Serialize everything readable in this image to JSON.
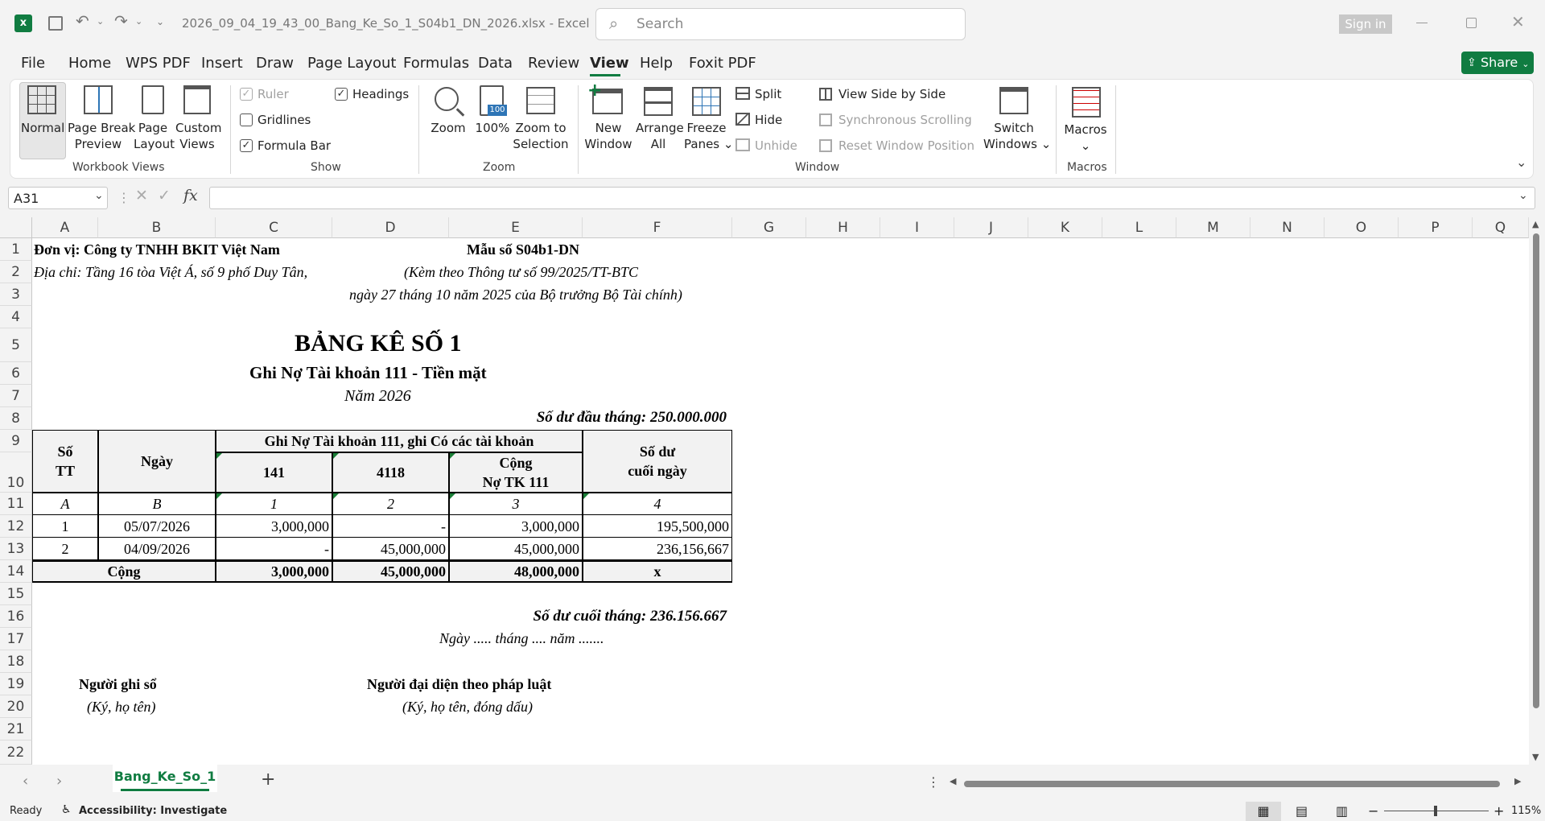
{
  "window": {
    "filename": "2026_09_04_19_43_00_Bang_Ke_So_1_S04b1_DN_2026.xlsx",
    "separator": "-",
    "app": "Excel",
    "search_placeholder": "Search",
    "sign_in": "Sign in"
  },
  "menu": [
    "File",
    "Home",
    "WPS PDF",
    "Insert",
    "Draw",
    "Page Layout",
    "Formulas",
    "Data",
    "Review",
    "View",
    "Help",
    "Foxit PDF"
  ],
  "share": "Share",
  "ribbon": {
    "workbook_views": {
      "normal": "Normal",
      "page_break": [
        "Page Break",
        "Preview"
      ],
      "page_layout": [
        "Page",
        "Layout"
      ],
      "custom": [
        "Custom",
        "Views"
      ],
      "label": "Workbook Views"
    },
    "show": {
      "ruler": "Ruler",
      "gridlines": "Gridlines",
      "formula_bar": "Formula Bar",
      "headings": "Headings",
      "label": "Show"
    },
    "zoom": {
      "zoom": "Zoom",
      "pct": "100%",
      "to_sel": [
        "Zoom to",
        "Selection"
      ],
      "label": "Zoom"
    },
    "window": {
      "new": [
        "New",
        "Window"
      ],
      "arrange": [
        "Arrange",
        "All"
      ],
      "freeze": [
        "Freeze",
        "Panes"
      ],
      "split": "Split",
      "hide": "Hide",
      "unhide": "Unhide",
      "side_by_side": "View Side by Side",
      "sync_scroll": "Synchronous Scrolling",
      "reset_pos": "Reset Window Position",
      "switch": [
        "Switch",
        "Windows"
      ],
      "label": "Window"
    },
    "macros": {
      "macros": "Macros",
      "label": "Macros"
    }
  },
  "formula_bar": {
    "name_box": "A31",
    "fx": "fx",
    "value": ""
  },
  "columns": [
    "A",
    "B",
    "C",
    "D",
    "E",
    "F",
    "G",
    "H",
    "I",
    "J",
    "K",
    "L",
    "M",
    "N",
    "O",
    "P",
    "Q"
  ],
  "rows": [
    "1",
    "2",
    "3",
    "4",
    "5",
    "6",
    "7",
    "8",
    "9",
    "10",
    "11",
    "12",
    "13",
    "14",
    "15",
    "16",
    "17",
    "18",
    "19",
    "20",
    "21",
    "22"
  ],
  "sheet": {
    "unit": "Đơn vị: Công ty TNHH BKIT Việt Nam",
    "form": "Mẫu số S04b1-DN",
    "address": "Địa chỉ: Tầng 16 tòa Việt Á, số 9 phố Duy Tân,",
    "circular": "(Kèm theo Thông tư số 99/2025/TT-BTC",
    "circular2": "ngày 27 tháng 10 năm 2025 của Bộ trưởng Bộ Tài chính)",
    "title": "BẢNG KÊ SỐ 1",
    "subtitle": "Ghi Nợ Tài khoản 111 - Tiền mặt",
    "year": "Năm 2026",
    "opening": "Số dư đầu tháng: 250.000.000",
    "h_stt": [
      "Số",
      "TT"
    ],
    "h_date": "Ngày",
    "h_group": "Ghi Nợ Tài khoản 111, ghi Có các tài khoản",
    "h_141": "141",
    "h_4118": "4118",
    "h_total": [
      "Cộng",
      "Nợ TK 111"
    ],
    "h_balance": [
      "Số dư",
      "cuối ngày"
    ],
    "codes": [
      "A",
      "B",
      "1",
      "2",
      "3",
      "4"
    ],
    "rows": [
      [
        "1",
        "05/07/2026",
        "3,000,000",
        "-",
        "3,000,000",
        "195,500,000"
      ],
      [
        "2",
        "04/09/2026",
        "-",
        "45,000,000",
        "45,000,000",
        "236,156,667"
      ]
    ],
    "total": [
      "Cộng",
      "3,000,000",
      "45,000,000",
      "48,000,000",
      "x"
    ],
    "closing": "Số dư cuối tháng: 236.156.667",
    "date_line": "Ngày ..... tháng .... năm .......",
    "signer1": "Người ghi sổ",
    "signer1_note": "(Ký, họ tên)",
    "signer2": "Người đại diện theo pháp luật",
    "signer2_note": "(Ký, họ tên, đóng dấu)"
  },
  "tab": "Bang_Ke_So_1",
  "status": {
    "ready": "Ready",
    "accessibility": "Accessibility: Investigate",
    "zoom": "115%"
  },
  "colors": {
    "excel_green": "#107c41",
    "share_green": "#107c41",
    "selected_tab_underline": "#107c41"
  }
}
